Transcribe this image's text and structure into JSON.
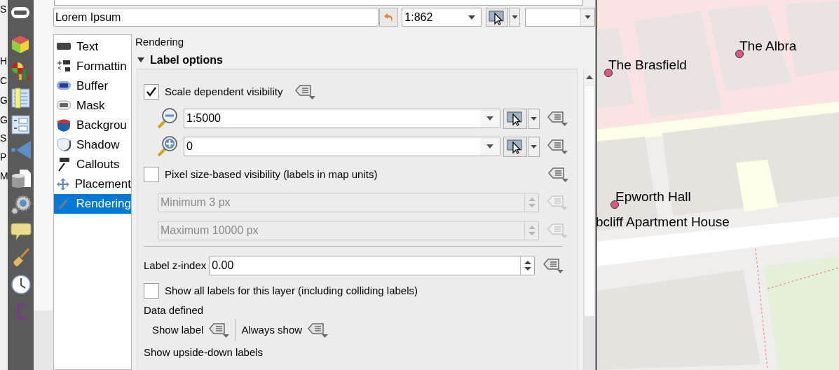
{
  "left_panel": {
    "letters": [
      "S",
      "H",
      "C",
      "G",
      "G",
      "S",
      "P",
      "M"
    ]
  },
  "layer_field": {
    "value": "Lorem Ipsum"
  },
  "scale_combo": {
    "value": "1:862"
  },
  "sections": [
    {
      "label": "Text",
      "selected": false
    },
    {
      "label": "Formattin",
      "selected": false
    },
    {
      "label": "Buffer",
      "selected": false
    },
    {
      "label": "Mask",
      "selected": false
    },
    {
      "label": "Backgrou",
      "selected": false
    },
    {
      "label": "Shadow",
      "selected": false
    },
    {
      "label": "Callouts",
      "selected": false
    },
    {
      "label": "Placement",
      "selected": false
    },
    {
      "label": "Rendering",
      "selected": true
    }
  ],
  "page_title": "Rendering",
  "group": {
    "title": "Label options",
    "expanded": true
  },
  "scale_visibility": {
    "label": "Scale dependent visibility",
    "checked": true,
    "min_scale": "1:5000",
    "max_scale": "0"
  },
  "pixel_visibility": {
    "label": "Pixel size-based visibility (labels in map units)",
    "checked": false,
    "minimum": "Minimum 3 px",
    "maximum": "Maximum 10000 px"
  },
  "z_index": {
    "label": "Label z-index",
    "value": "0.00"
  },
  "show_all": {
    "label": "Show all labels for this layer (including colliding labels)",
    "checked": false
  },
  "data_defined": {
    "title": "Data defined",
    "items": [
      "Show label",
      "Always show"
    ]
  },
  "upside_down": {
    "title": "Show upside-down labels"
  },
  "map": {
    "labels": [
      {
        "text": "The Brasfield",
        "dot": true
      },
      {
        "text": "The Albra",
        "dot": true
      },
      {
        "text": "Epworth Hall",
        "dot": true
      },
      {
        "text": "bcliff Apartment House",
        "dot": false
      }
    ]
  }
}
